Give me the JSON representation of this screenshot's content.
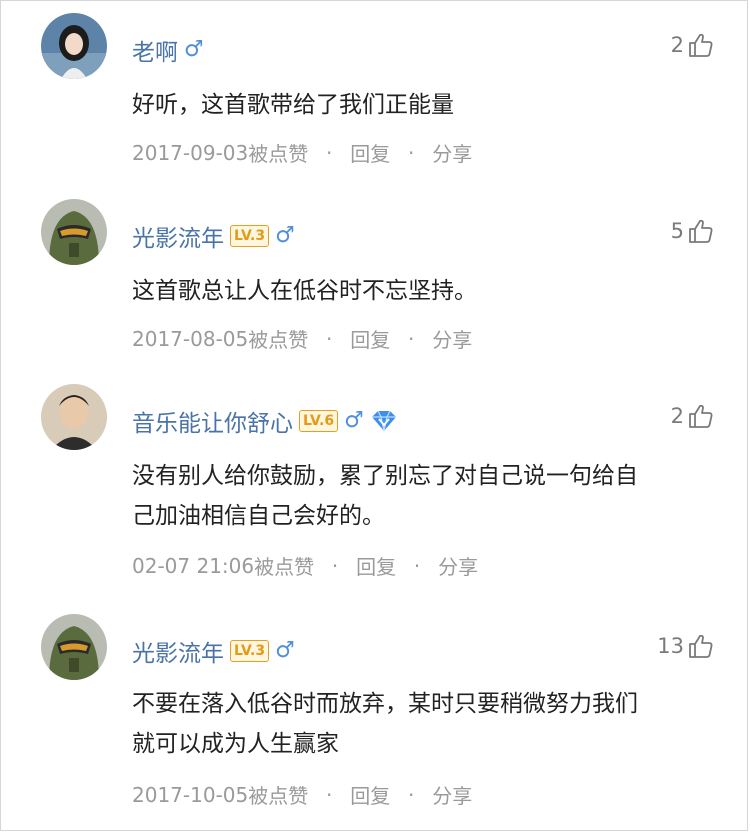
{
  "comments": [
    {
      "username": "老啊",
      "gender_icon": "♂",
      "likes": "2",
      "text": "好听，这首歌带给了我们正能量",
      "date": "2017-09-03",
      "liked_by_label": "被点赞",
      "reply_label": "回复",
      "share_label": "分享"
    },
    {
      "username": "光影流年",
      "level": "LV.3",
      "gender_icon": "♂",
      "likes": "5",
      "text": "这首歌总让人在低谷时不忘坚持。",
      "date": "2017-08-05",
      "liked_by_label": "被点赞",
      "reply_label": "回复",
      "share_label": "分享"
    },
    {
      "username": "音乐能让你舒心",
      "level": "LV.6",
      "gender_icon": "♂",
      "likes": "2",
      "text_line1": "没有别人给你鼓励，累了别忘了对自己说一句给自",
      "text_line2": "己加油相信自己会好的。",
      "date": "02-07 21:06",
      "liked_by_label": "被点赞",
      "reply_label": "回复",
      "share_label": "分享"
    },
    {
      "username": "光影流年",
      "level": "LV.3",
      "gender_icon": "♂",
      "likes": "13",
      "text_line1": "不要在落入低谷时而放弃，某时只要稍微努力我们",
      "text_line2": "就可以成为人生赢家",
      "date": "2017-10-05",
      "liked_by_label": "被点赞",
      "reply_label": "回复",
      "share_label": "分享"
    }
  ],
  "meta_separator": "·",
  "colors": {
    "username": "#4a73a8",
    "level_badge": "#e7a01e",
    "gender_male": "#4f8fdc",
    "vip_diamond": "#3e8ef0",
    "meta_text": "#9a9a9a",
    "body_text": "#222222"
  }
}
